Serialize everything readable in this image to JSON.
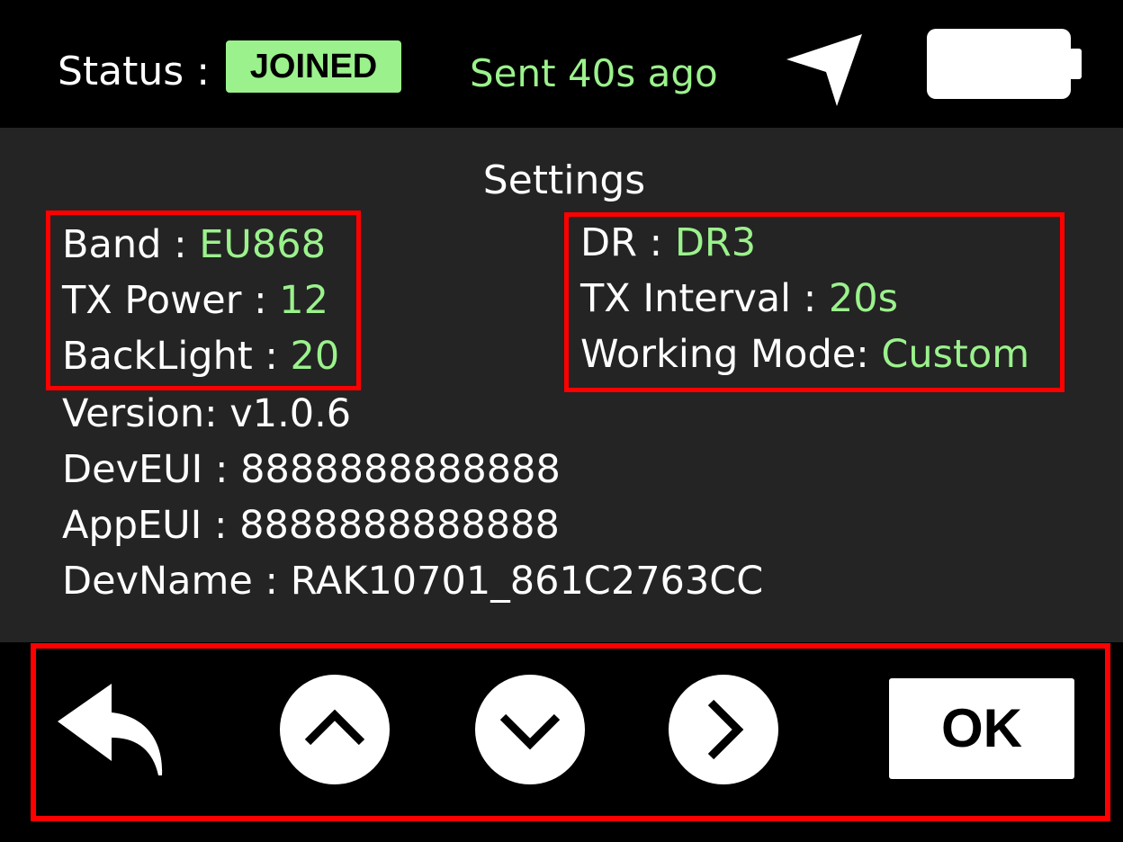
{
  "status_bar": {
    "status_label": "Status :",
    "status_badge": "JOINED",
    "sent_text": "Sent 40s ago",
    "icons": [
      "navigation-arrow-icon",
      "battery-icon"
    ]
  },
  "settings": {
    "title": "Settings",
    "band_label": "Band : ",
    "band_value": "EU868",
    "tx_power_label": "TX Power : ",
    "tx_power_value": "12",
    "backlight_label": "BackLight : ",
    "backlight_value": "20",
    "dr_label": "DR : ",
    "dr_value": "DR3",
    "tx_interval_label": "TX Interval : ",
    "tx_interval_value": "20s",
    "working_mode_label": "Working Mode: ",
    "working_mode_value": "Custom",
    "version_line": "Version: v1.0.6",
    "deveui_line": "DevEUI : 8888888888888",
    "appeui_line": "AppEUI : 8888888888888",
    "devname_line": "DevName : RAK10701_861C2763CC"
  },
  "controls": {
    "ok_label": "OK",
    "icons": [
      "back-arrow-icon",
      "chevron-up-icon",
      "chevron-down-icon",
      "chevron-right-icon"
    ]
  },
  "colors": {
    "accent_green": "#9bf28c",
    "highlight_red": "#ff0000",
    "panel_bg": "#242424",
    "bar_bg": "#000000"
  }
}
